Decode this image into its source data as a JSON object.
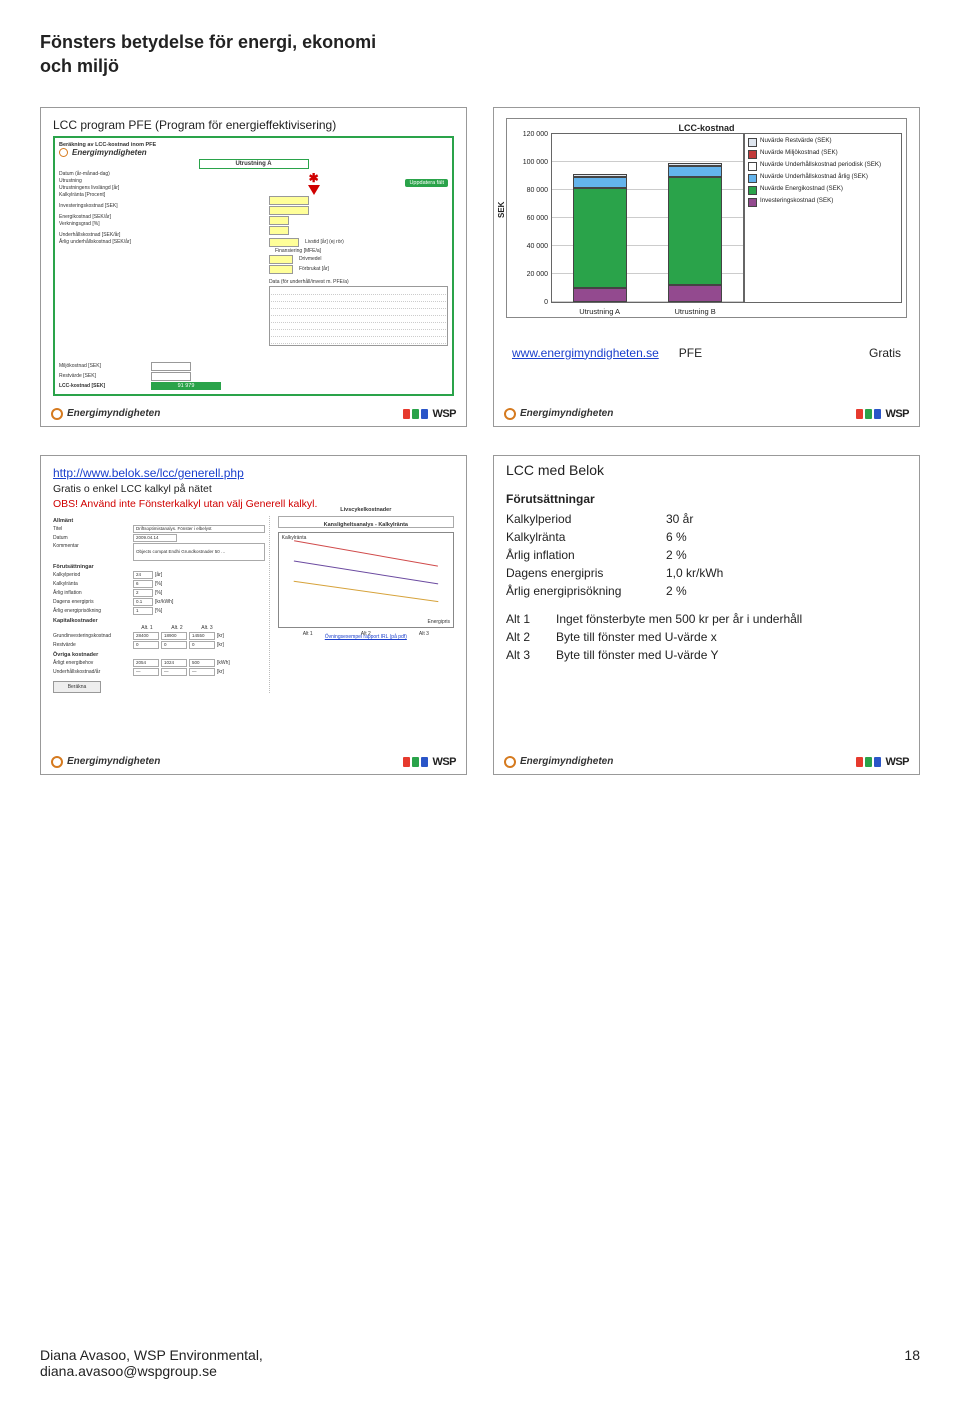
{
  "page": {
    "title_line1": "Fönsters betydelse för energi, ekonomi",
    "title_line2": "och miljö"
  },
  "slide1": {
    "heading": "LCC program PFE (Program för energieffektivisering)",
    "form_header": "Beräkning av LCC-kostnad inom PFE",
    "brand": "Energimyndigheten",
    "section_title": "Utrustning A",
    "fields": {
      "datum_label": "Datum (år-månad-dag)",
      "utrustning_label": "Utrustning",
      "drifttid_label": "Utrustningens livslängd [år]",
      "kalkylranta_label": "Kalkylränta [Procent]",
      "invest_label": "Investeringskostnad [SEK]",
      "energi_label": "Energikostnad [SEK/år]",
      "verkn_label": "Verkningsgrad [%]",
      "underh_label": "Underhållskostnad [SEK/år]",
      "arlig_label": "Årlig underhållskostnad [SEK/år]",
      "uppdatera": "Uppdatera fält",
      "livstid": "Livstid [år] (ej rör)",
      "finansiering": "Finansiering [MFE/a]",
      "drivmedel": "Drivmedel",
      "forbrukat": "Förbrukat [år]",
      "extra_section": "Data (för underhåll/invest m. PFE/a)",
      "milj_label": "Miljökostnad [SEK]",
      "rest_label": "Restvärde [SEK]",
      "lcc_label": "LCC-kostnad [SEK]",
      "lcc_value": "91 979"
    }
  },
  "slide2": {
    "chart_title": "LCC-kostnad",
    "ylabel": "SEK",
    "legend": {
      "rest": "Nuvärde Restvärde (SEK)",
      "miljo": "Nuvärde Miljökostnad (SEK)",
      "uh_periodisk": "Nuvärde Underhållskostnad periodisk (SEK)",
      "uh_arlig": "Nuvärde Underhållskostnad årlig (SEK)",
      "energi": "Nuvärde Energikostnad (SEK)",
      "invest": "Investeringskostnad (SEK)"
    },
    "xcats": [
      "Utrustning A",
      "Utrustning B"
    ],
    "link": "www.energimyndigheten.se",
    "link_after": "PFE",
    "right_text": "Gratis"
  },
  "chart_data": {
    "type": "bar",
    "title": "LCC-kostnad",
    "ylabel": "SEK",
    "ylim": [
      0,
      120000
    ],
    "yticks": [
      0,
      20000,
      40000,
      60000,
      80000,
      100000,
      120000
    ],
    "categories": [
      "Utrustning A",
      "Utrustning B"
    ],
    "series": [
      {
        "name": "Investeringskostnad (SEK)",
        "color": "#934a8f",
        "values": [
          10000,
          12000
        ]
      },
      {
        "name": "Nuvärde Energikostnad (SEK)",
        "color": "#2aa34a",
        "values": [
          72000,
          78000
        ]
      },
      {
        "name": "Nuvärde Underhållskostnad årlig (SEK)",
        "color": "#64b4ec",
        "values": [
          8000,
          8000
        ]
      },
      {
        "name": "Nuvärde Underhållskostnad periodisk (SEK)",
        "color": "#ffffff",
        "values": [
          0,
          0
        ]
      },
      {
        "name": "Nuvärde Miljökostnad (SEK)",
        "color": "#c13a3a",
        "values": [
          0,
          0
        ]
      },
      {
        "name": "Nuvärde Restvärde (SEK)",
        "color": "#dfe6ef",
        "values": [
          2000,
          2000
        ]
      }
    ]
  },
  "slide3": {
    "url": "http://www.belok.se/lcc/generell.php",
    "sub": "Gratis o enkel LCC kalkyl på nätet",
    "obs": "OBS! Använd inte Fönsterkalkyl utan välj Generell kalkyl.",
    "form": {
      "sec_allmant": "Allmänt",
      "titel_lbl": "Titel",
      "titel_val": "Driftsoptimistanalys. Fönster i elbelyst",
      "datum_lbl": "Datum",
      "datum_val": "2009.04.14",
      "kommentar_lbl": "Kommentar",
      "kommentar_val": "Objects compat Endhi Grundkostnader 50 …",
      "sec_forut": "Förutsättningar",
      "kalkylperiod_lbl": "Kalkylperiod",
      "kalkylperiod_val": "24",
      "kalkylperiod_unit": "[år]",
      "kalkylranta_lbl": "Kalkylränta",
      "kalkylranta_val": "6",
      "kalkylranta_unit": "[%]",
      "infl_lbl": "Årlig inflation",
      "infl_val": "2",
      "infl_unit": "[%]",
      "dagpris_lbl": "Dagens energipris",
      "dagpris_val": "0.1",
      "dagpris_unit": "[kr/kWh]",
      "prisok_lbl": "Årlig energiprisökning",
      "prisok_val": "1",
      "prisok_unit": "[%]",
      "sec_kap": "Kapitalkostnader",
      "alt_hdr": [
        "Alt. 1",
        "Alt. 2",
        "Alt. 3"
      ],
      "grundinv_lbl": "Grundinvesteringskostnad",
      "grundinv_vals": [
        "28400",
        "18900",
        "14550"
      ],
      "grundinv_unit": "[kr]",
      "restv_lbl": "Restvärde",
      "restv_vals": [
        "0",
        "0",
        "0"
      ],
      "restv_unit": "[kr]",
      "sec_ov": "Övriga kostnader",
      "arlen_lbl": "Årligt energibehov",
      "arlen_vals": [
        "2054",
        "1024",
        "500"
      ],
      "arlen_unit": "[kWh]",
      "uhk_lbl": "Underhållskostnad/år",
      "uhk_vals": [
        "—",
        "—",
        "—"
      ],
      "uhk_unit": "[kr]",
      "berakna": "Beräkna",
      "chart_top_title": "Livscykelkostnader",
      "chart2_title": "Kansligheltsanalys - Kalkylränta",
      "chart2_ylab": "Kalkylränta",
      "chart2_xlab": "Energipris",
      "legendline": [
        "Alt 1",
        "Alt 2",
        "Alt 3"
      ],
      "underlink": "Övningsexempel rapport IRL (på pdf)"
    }
  },
  "slide4": {
    "title": "LCC med Belok",
    "sub": "Förutsättningar",
    "rows": {
      "kalkylperiod_l": "Kalkylperiod",
      "kalkylperiod_v": "30 år",
      "kalkylranta_l": "Kalkylränta",
      "kalkylranta_v": "6 %",
      "infl_l": "Årlig inflation",
      "infl_v": "2 %",
      "pris_l": "Dagens energipris",
      "pris_v": "1,0 kr/kWh",
      "prisok_l": "Årlig energiprisökning",
      "prisok_v": "2 %"
    },
    "alts": {
      "a1_l": "Alt 1",
      "a1_v": "Inget fönsterbyte men 500 kr per år i underhåll",
      "a2_l": "Alt 2",
      "a2_v": "Byte till fönster med U-värde x",
      "a3_l": "Alt 3",
      "a3_v": "Byte till fönster med U-värde Y"
    }
  },
  "common_footer": {
    "em": "Energimyndigheten",
    "wsp": "WSP"
  },
  "page_footer": {
    "left_line1": "Diana Avasoo, WSP Environmental,",
    "left_line2": "diana.avasoo@wspgroup.se",
    "right": "18"
  }
}
